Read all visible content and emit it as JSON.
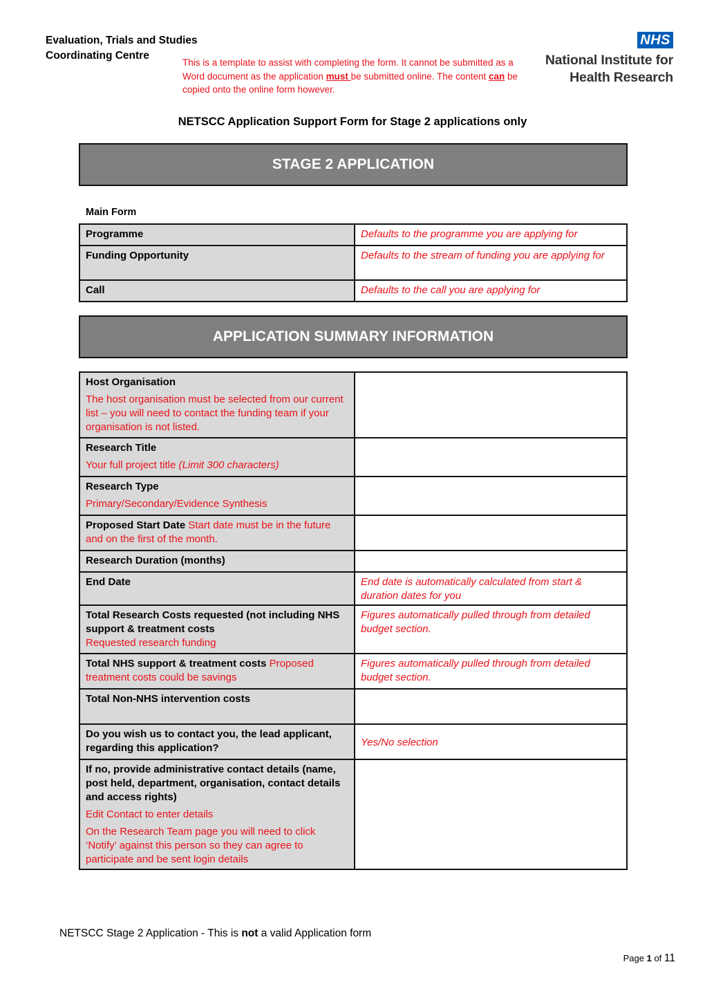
{
  "header": {
    "org_line1": "Evaluation, Trials and Studies",
    "org_line2": "Coordinating Centre",
    "notice": {
      "part1": "This is a template to assist with completing the form. It cannot be submitted as a Word document as the application ",
      "emph1": "must ",
      "part2": "be submitted online. The content ",
      "emph2": "can",
      "part3": " be copied onto the online form however."
    },
    "logo": {
      "badge": "NHS",
      "line1": "National Institute for",
      "line2": "Health Research",
      "badge_color": "#005eb8"
    }
  },
  "form_title": "NETSCC Application Support Form for Stage 2 applications only",
  "stage_banner": "STAGE 2 APPLICATION",
  "main_form": {
    "label": "Main Form",
    "rows": [
      {
        "label": "Programme",
        "value": "Defaults to the programme you are applying for"
      },
      {
        "label": "Funding Opportunity",
        "value": "Defaults to the stream of funding you are applying for"
      },
      {
        "label": "Call",
        "value": "Defaults to the call you are applying for"
      }
    ]
  },
  "summary_banner": "APPLICATION SUMMARY INFORMATION",
  "summary": {
    "host_org": {
      "label": "Host Organisation",
      "hint": "The host organisation must be selected from our current list – you will need to contact the funding team if your organisation is not listed."
    },
    "research_title": {
      "label": "Research Title",
      "hint": "Your full project title ",
      "hint_italic": "(Limit 300 characters)"
    },
    "research_type": {
      "label": "Research Type",
      "hint": "Primary/Secondary/Evidence Synthesis"
    },
    "start_date": {
      "label": "Proposed Start Date",
      "hint": " Start date must be in the future and on the first of the month."
    },
    "duration": {
      "label": "Research Duration (months)"
    },
    "end_date": {
      "label": "End Date",
      "value": "End date is automatically calculated from start & duration dates for you"
    },
    "total_research_costs": {
      "label": "Total Research Costs requested (not including NHS support & treatment costs",
      "hint": "Requested research funding",
      "value": "Figures automatically pulled through from detailed budget section."
    },
    "total_nhs_costs": {
      "label": "Total NHS support & treatment costs",
      "hint": " Proposed treatment costs could be savings",
      "value": "Figures automatically pulled through from detailed budget section."
    },
    "non_nhs_costs": {
      "label": "Total Non-NHS intervention costs"
    },
    "contact_lead": {
      "label": "Do you wish us to contact you, the lead applicant, regarding this application?",
      "value": "Yes/No selection"
    },
    "admin_contact": {
      "label": "If no, provide administrative contact details (name, post held, department, organisation, contact details and access rights)",
      "hint1": "Edit Contact to enter details",
      "hint2": "On the Research Team page you will need to click ‘Notify’ against this person so they can agree to participate and be sent login details"
    }
  },
  "footer": {
    "text_before": "NETSCC Stage 2 Application - This is ",
    "text_bold": "not",
    "text_after": " a valid Application form",
    "page_label": "Page ",
    "page_current": "1",
    "page_of": " of ",
    "page_total": "11"
  }
}
